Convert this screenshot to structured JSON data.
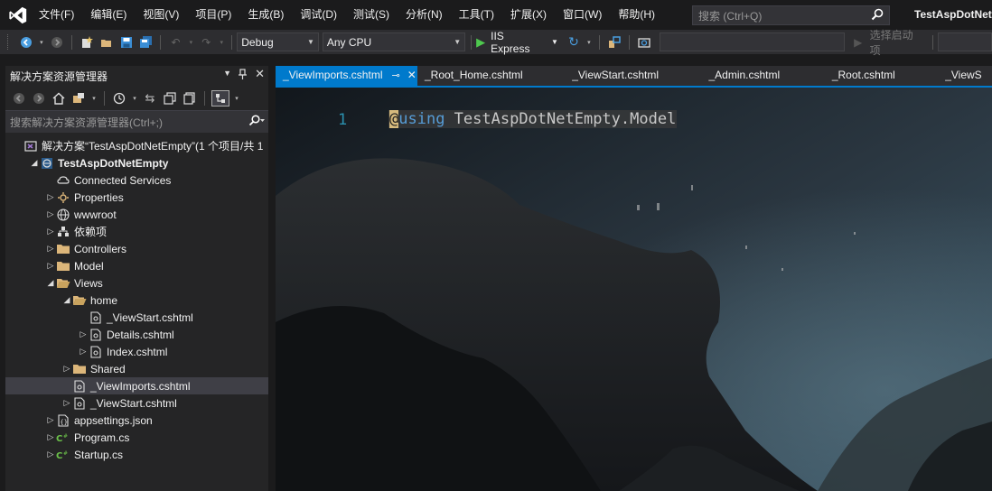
{
  "menubar": {
    "items": [
      "文件(F)",
      "编辑(E)",
      "视图(V)",
      "项目(P)",
      "生成(B)",
      "调试(D)",
      "测试(S)",
      "分析(N)",
      "工具(T)",
      "扩展(X)",
      "窗口(W)",
      "帮助(H)"
    ],
    "quick_launch_placeholder": "搜索 (Ctrl+Q)",
    "solution_title": "TestAspDotNet"
  },
  "toolbar": {
    "config": "Debug",
    "platform": "Any CPU",
    "run_target": "IIS Express",
    "startup_item": "选择启动项"
  },
  "solution_explorer": {
    "title": "解决方案资源管理器",
    "search_placeholder": "搜索解决方案资源管理器(Ctrl+;)",
    "tree": [
      {
        "label": "解决方案“TestAspDotNetEmpty”(1 个项目/共 1",
        "indent": 0,
        "expander": "",
        "icon": "solution-icon",
        "bold": false
      },
      {
        "label": "TestAspDotNetEmpty",
        "indent": 1,
        "expander": "◢",
        "icon": "web-project-icon",
        "bold": true
      },
      {
        "label": "Connected Services",
        "indent": 2,
        "expander": "",
        "icon": "connected-services-icon",
        "bold": false
      },
      {
        "label": "Properties",
        "indent": 2,
        "expander": "▷",
        "icon": "properties-icon",
        "bold": false
      },
      {
        "label": "wwwroot",
        "indent": 2,
        "expander": "▷",
        "icon": "globe-icon",
        "bold": false
      },
      {
        "label": "依赖项",
        "indent": 2,
        "expander": "▷",
        "icon": "dependencies-icon",
        "bold": false
      },
      {
        "label": "Controllers",
        "indent": 2,
        "expander": "▷",
        "icon": "folder-icon",
        "bold": false
      },
      {
        "label": "Model",
        "indent": 2,
        "expander": "▷",
        "icon": "folder-icon",
        "bold": false
      },
      {
        "label": "Views",
        "indent": 2,
        "expander": "◢",
        "icon": "folder-open-icon",
        "bold": false
      },
      {
        "label": "home",
        "indent": 3,
        "expander": "◢",
        "icon": "folder-open-icon",
        "bold": false
      },
      {
        "label": "_ViewStart.cshtml",
        "indent": 4,
        "expander": "",
        "icon": "razor-file-icon",
        "bold": false
      },
      {
        "label": "Details.cshtml",
        "indent": 4,
        "expander": "▷",
        "icon": "razor-file-icon",
        "bold": false
      },
      {
        "label": "Index.cshtml",
        "indent": 4,
        "expander": "▷",
        "icon": "razor-file-icon",
        "bold": false
      },
      {
        "label": "Shared",
        "indent": 3,
        "expander": "▷",
        "icon": "folder-icon",
        "bold": false
      },
      {
        "label": "_ViewImports.cshtml",
        "indent": 3,
        "expander": "",
        "icon": "razor-file-icon",
        "bold": false,
        "selected": true
      },
      {
        "label": "_ViewStart.cshtml",
        "indent": 3,
        "expander": "▷",
        "icon": "razor-file-icon",
        "bold": false
      },
      {
        "label": "appsettings.json",
        "indent": 2,
        "expander": "▷",
        "icon": "json-file-icon",
        "bold": false
      },
      {
        "label": "Program.cs",
        "indent": 2,
        "expander": "▷",
        "icon": "csharp-file-icon",
        "bold": false
      },
      {
        "label": "Startup.cs",
        "indent": 2,
        "expander": "▷",
        "icon": "csharp-file-icon",
        "bold": false
      }
    ]
  },
  "editor": {
    "tabs": [
      "_ViewImports.cshtml",
      "_Root_Home.cshtml",
      "_ViewStart.cshtml",
      "_Admin.cshtml",
      "_Root.cshtml",
      "_ViewS"
    ],
    "active_tab_pin": "⊸",
    "active_tab_close": "✕",
    "line_number": "1",
    "code": {
      "at": "@",
      "keyword": "using",
      "namespace": " TestAspDotNetEmpty.Model"
    }
  },
  "colors": {
    "accent": "#007acc",
    "background": "#1b1b1c",
    "panel": "#252526"
  }
}
